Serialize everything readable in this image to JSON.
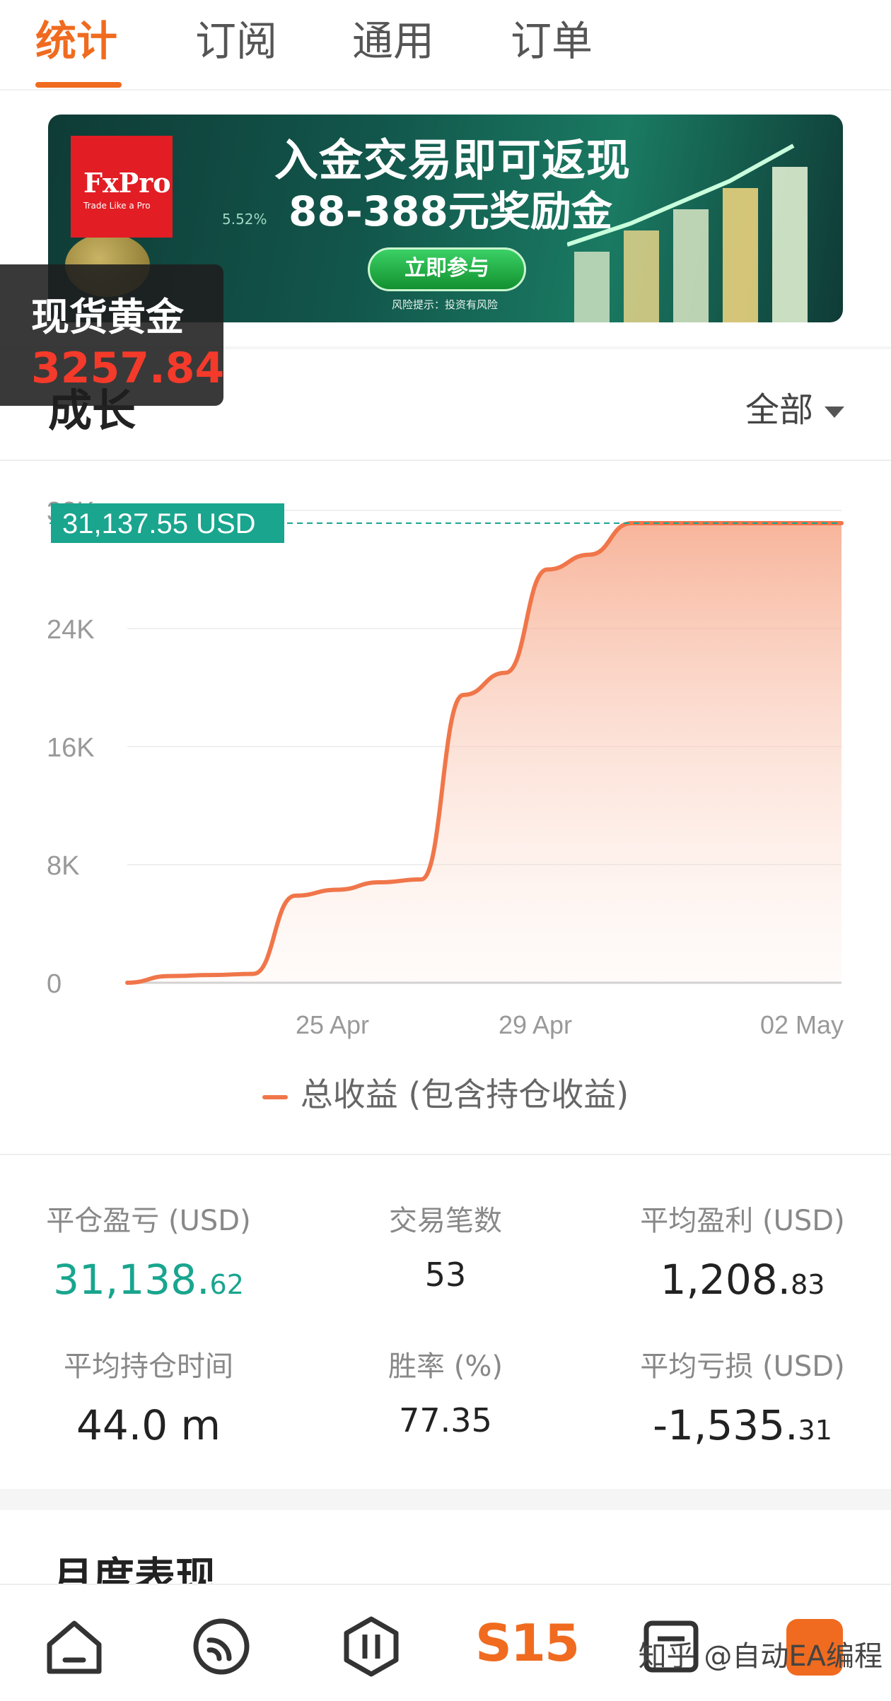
{
  "tabs": [
    {
      "label": "统计",
      "active": true
    },
    {
      "label": "订阅",
      "active": false
    },
    {
      "label": "通用",
      "active": false
    },
    {
      "label": "订单",
      "active": false
    }
  ],
  "banner": {
    "brand": "FxPro",
    "slogan": "Trade Like a Pro",
    "headline": "入金交易即可返现",
    "subline": "88-388元奖励金",
    "cta": "立即参与",
    "risk": "风险提示：投资有风险",
    "pct": "5.52%"
  },
  "gold_overlay": {
    "name": "现货黄金",
    "price": "3257.84"
  },
  "growth": {
    "title": "成长",
    "filter": "全部"
  },
  "chart_data": {
    "type": "area",
    "current_label": "31,137.55 USD",
    "yticks": [
      "0",
      "8K",
      "16K",
      "24K",
      "32K"
    ],
    "ylim": [
      0,
      32000
    ],
    "xticks": [
      "25 Apr",
      "29 Apr",
      "02 May"
    ],
    "x": [
      0,
      1,
      2,
      3,
      4,
      5,
      6,
      7,
      8,
      9,
      10,
      11,
      12,
      13,
      14,
      15,
      16,
      17
    ],
    "values": [
      0,
      450,
      520,
      600,
      5900,
      6300,
      6800,
      7000,
      19500,
      21000,
      28000,
      29000,
      31137.55,
      31137.55,
      31137.55,
      31137.55,
      31137.55,
      31137.55
    ],
    "legend": "总收益 (包含持仓收益)",
    "colors": {
      "line": "#f0764a",
      "fill": "#f8b49b",
      "ref": "#19a58e"
    }
  },
  "stats": [
    {
      "label": "平仓盈亏 (USD)",
      "int": "31,138.",
      "dec": "62"
    },
    {
      "label": "交易笔数",
      "int": "53",
      "dec": ""
    },
    {
      "label": "平均盈利 (USD)",
      "int": "1,208.",
      "dec": "83"
    },
    {
      "label": "平均持仓时间",
      "int": "44.0 m",
      "dec": ""
    },
    {
      "label": "胜率 (%)",
      "int": "77.35",
      "dec": ""
    },
    {
      "label": "平均亏损 (USD)",
      "int": "-1,535.",
      "dec": "31"
    }
  ],
  "monthly": {
    "title": "月度表现"
  },
  "nav": {
    "s15": "S15",
    "watermark": "知乎 @自动EA编程",
    "icons": [
      "home-icon",
      "subscribe-icon",
      "trade-icon",
      "s15-logo",
      "news-icon",
      "badge-icon"
    ]
  }
}
